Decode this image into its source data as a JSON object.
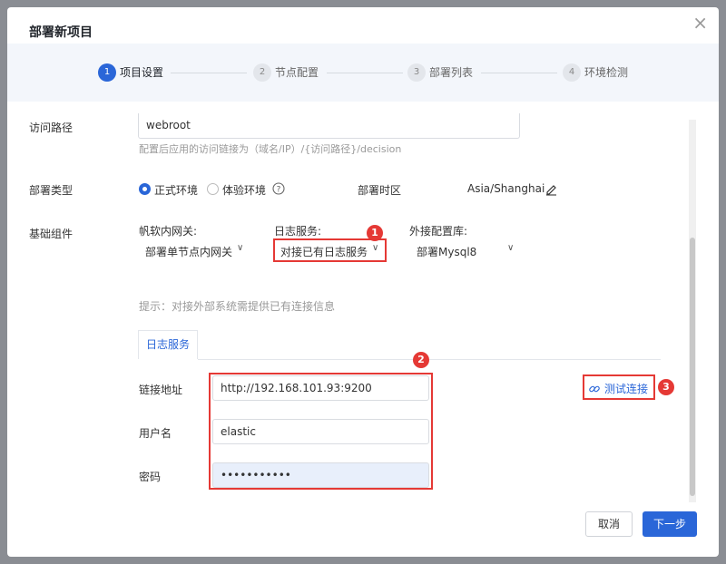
{
  "dialog": {
    "title": "部署新项目",
    "close_glyph": "×"
  },
  "steps": [
    {
      "num": "1",
      "label": "项目设置",
      "active": true
    },
    {
      "num": "2",
      "label": "节点配置",
      "active": false
    },
    {
      "num": "3",
      "label": "部署列表",
      "active": false
    },
    {
      "num": "4",
      "label": "环境检测",
      "active": false
    }
  ],
  "access_path": {
    "label": "访问路径",
    "value": "webroot",
    "hint": "配置后应用的访问链接为（域名/IP）/{访问路径}/decision"
  },
  "deploy_type": {
    "label": "部署类型",
    "options": [
      "正式环境",
      "体验环境"
    ],
    "selected": "正式环境",
    "help_icon": "help-circle-icon",
    "timezone_label": "部署时区",
    "timezone_value": "Asia/Shanghai",
    "edit_icon": "edit-icon"
  },
  "base_components": {
    "label": "基础组件",
    "gateway_label": "帆软内网关:",
    "gateway_value": "部署单节点内网关",
    "log_label": "日志服务:",
    "log_value": "对接已有日志服务",
    "db_label": "外接配置库:",
    "db_value": "部署Mysql8",
    "hint": "提示：对接外部系统需提供已有连接信息",
    "chevron": "∨"
  },
  "log_tab": {
    "label": "日志服务",
    "url_label": "链接地址",
    "url_value": "http://192.168.101.93:9200",
    "user_label": "用户名",
    "user_value": "elastic",
    "pwd_label": "密码",
    "pwd_value": "•••••••••••",
    "test_button": "测试连接"
  },
  "annotations": [
    "1",
    "2",
    "3"
  ],
  "footer": {
    "cancel": "取消",
    "next": "下一步"
  },
  "colors": {
    "accent": "#2a66d8",
    "annotation": "#e53935"
  }
}
